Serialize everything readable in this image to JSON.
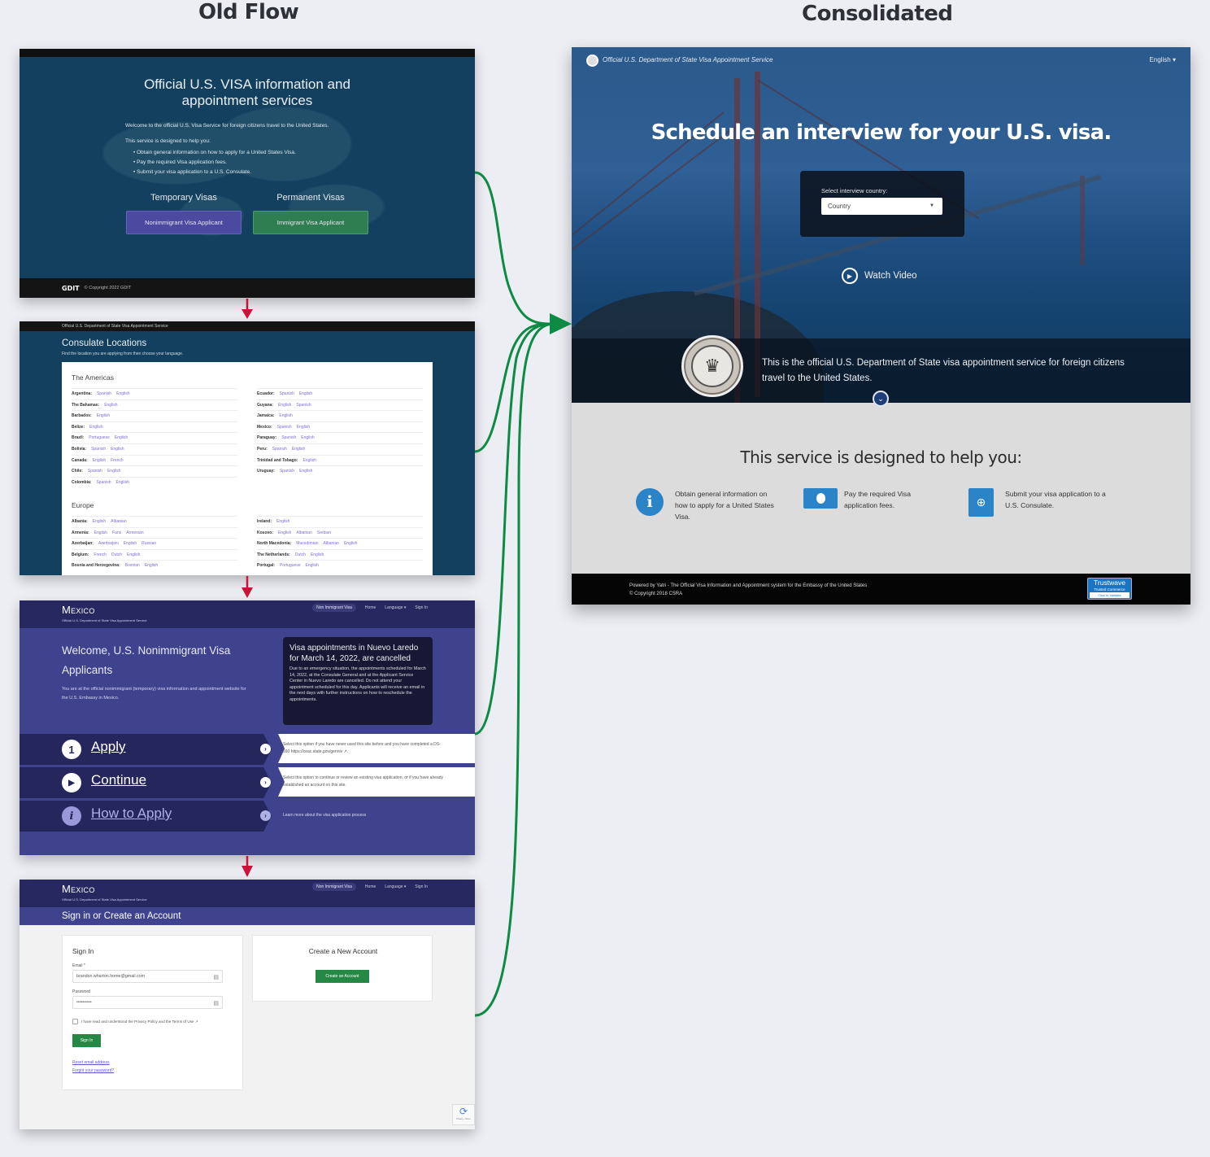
{
  "titles": {
    "old_flow": "Old Flow",
    "consolidated": "Consolidated"
  },
  "colors": {
    "flow_arrow": "#0d8a44",
    "step_arrow": "#d0103a",
    "old_bg": "#13405f",
    "mexico_purple": "#3f428c",
    "green_button": "#268845"
  },
  "screen1": {
    "heading": "Official U.S. VISA information and appointment services",
    "welcome": "Welcome to the official U.S. Visa Service for foreign citizens travel to the United States.",
    "designed": "This service is designed to help you:",
    "bullets": [
      "Obtain general information on how to apply for a United States Visa.",
      "Pay the required Visa application fees.",
      "Submit your visa application to a U.S. Consulate."
    ],
    "temporary_title": "Temporary Visas",
    "permanent_title": "Permanent Visas",
    "nonimmigrant_button": "Nonimmigrant Visa Applicant",
    "immigrant_button": "Immigrant Visa Applicant",
    "footer_logo": "GDIT",
    "footer_copy": "© Copyright 2022 GDIT"
  },
  "screen2": {
    "topbar": "Official U.S. Department of State Visa Appointment Service",
    "title": "Consulate Locations",
    "subtitle": "Find the location you are applying from then choose your language.",
    "regions": [
      {
        "name": "The Americas",
        "left": [
          {
            "country": "Argentina:",
            "langs": [
              "Spanish",
              "English"
            ]
          },
          {
            "country": "The Bahamas:",
            "langs": [
              "English"
            ]
          },
          {
            "country": "Barbados:",
            "langs": [
              "English"
            ]
          },
          {
            "country": "Belize:",
            "langs": [
              "English"
            ]
          },
          {
            "country": "Brazil:",
            "langs": [
              "Portuguese",
              "English"
            ]
          },
          {
            "country": "Bolivia:",
            "langs": [
              "Spanish",
              "English"
            ]
          },
          {
            "country": "Canada:",
            "langs": [
              "English",
              "French"
            ]
          },
          {
            "country": "Chile:",
            "langs": [
              "Spanish",
              "English"
            ]
          },
          {
            "country": "Colombia:",
            "langs": [
              "Spanish",
              "English"
            ]
          }
        ],
        "right": [
          {
            "country": "Ecuador:",
            "langs": [
              "Spanish",
              "English"
            ]
          },
          {
            "country": "Guyana:",
            "langs": [
              "English",
              "Spanish"
            ]
          },
          {
            "country": "Jamaica:",
            "langs": [
              "English"
            ]
          },
          {
            "country": "Mexico:",
            "langs": [
              "Spanish",
              "English"
            ]
          },
          {
            "country": "Paraguay:",
            "langs": [
              "Spanish",
              "English"
            ]
          },
          {
            "country": "Peru:",
            "langs": [
              "Spanish",
              "English"
            ]
          },
          {
            "country": "Trinidad and Tobago:",
            "langs": [
              "English"
            ]
          },
          {
            "country": "Uruguay:",
            "langs": [
              "Spanish",
              "English"
            ]
          }
        ]
      },
      {
        "name": "Europe",
        "left": [
          {
            "country": "Albania:",
            "langs": [
              "English",
              "Albanian"
            ]
          },
          {
            "country": "Armenia:",
            "langs": [
              "English",
              "Farsi",
              "Armenian"
            ]
          },
          {
            "country": "Azerbaijan:",
            "langs": [
              "Azerbaijani",
              "English",
              "Russian"
            ]
          },
          {
            "country": "Belgium:",
            "langs": [
              "French",
              "Dutch",
              "English"
            ]
          },
          {
            "country": "Bosnia and Herzegovina:",
            "langs": [
              "Bosnian",
              "English"
            ]
          }
        ],
        "right": [
          {
            "country": "Ireland:",
            "langs": [
              "English"
            ]
          },
          {
            "country": "Kosovo:",
            "langs": [
              "English",
              "Albanian",
              "Serbian"
            ]
          },
          {
            "country": "North Macedonia:",
            "langs": [
              "Macedonian",
              "Albanian",
              "English"
            ]
          },
          {
            "country": "The Netherlands:",
            "langs": [
              "Dutch",
              "English"
            ]
          },
          {
            "country": "Portugal:",
            "langs": [
              "Portuguese",
              "English"
            ]
          }
        ]
      }
    ]
  },
  "mexico_header": {
    "brand": "Mexico",
    "sub": "Official U.S. Department of State Visa Appointment Service",
    "nav": [
      "Non Immigrant Visa",
      "Home",
      "Language ▾",
      "Sign In"
    ]
  },
  "screen3": {
    "welcome": "Welcome, U.S. Nonimmigrant Visa Applicants",
    "welcome_text": "You are at the official nonimmigrant (temporary) visa information and appointment website for the U.S. Embassy in Mexico.",
    "alert_title": "Visa appointments in Nuevo Laredo for March 14, 2022, are cancelled",
    "alert_body": "Due to an emergency situation, the appointments scheduled for March 14, 2022, at the Consulate General and at the Applicant Service Center in Nuevo Laredo are cancelled. Do not attend your appointment scheduled for this day. Applicants will receive an email in the next days with further instructions on how to reschedule the appointments.",
    "options": [
      {
        "icon": "1",
        "label": "Apply",
        "desc": "Select this option if you have never used this site before and you have completed a DS-160 https://ceac.state.gov/genniv ↗."
      },
      {
        "icon": "▶",
        "label": "Continue",
        "desc": "Select this option to continue or review an existing visa application, or if you have already established an account on this site."
      },
      {
        "icon": "i",
        "label": "How to Apply",
        "desc": "Learn more about the visa application process"
      }
    ]
  },
  "screen4": {
    "title": "Sign in or Create an Account",
    "signin_title": "Sign In",
    "email_label": "Email *",
    "email_value": "brandon.wharton.home@gmail.com",
    "password_label": "Password",
    "password_value": "••••••••••",
    "terms": "I have read and understood the Privacy Policy and the Terms of Use ↗",
    "signin_button": "Sign In",
    "reset_email": "Reset email address",
    "forgot_password": "Forgot your password?",
    "create_title": "Create a New Account",
    "create_button": "Create an Account",
    "recaptcha": "Privacy - Terms"
  },
  "consolidated": {
    "header_title": "Official U.S. Department of State Visa Appointment Service",
    "language": "English ▾",
    "headline": "Schedule an interview for your U.S. visa.",
    "select_label": "Select interview country:",
    "select_value": "Country",
    "watch_video": "Watch Video",
    "official_text": "This is the official U.S. Department of State visa appointment  service for foreign citizens travel to the United States.",
    "help_title": "This service is designed to help you:",
    "help_items": [
      {
        "icon": "info-icon",
        "text": "Obtain general information on how to apply for a United States Visa."
      },
      {
        "icon": "money-icon",
        "text": "Pay the required Visa application fees."
      },
      {
        "icon": "passport-icon",
        "text": "Submit your visa application to a U.S. Consulate."
      }
    ],
    "footer_line1": "Powered by Yatri - The Official Visa Information and Appointment system for the Embassy of the United States",
    "footer_line2": "© Copyright 2018 CSRA",
    "trustwave_1": "Trustwave",
    "trustwave_2": "Trusted Commerce",
    "trustwave_3": "Click to Validate"
  }
}
